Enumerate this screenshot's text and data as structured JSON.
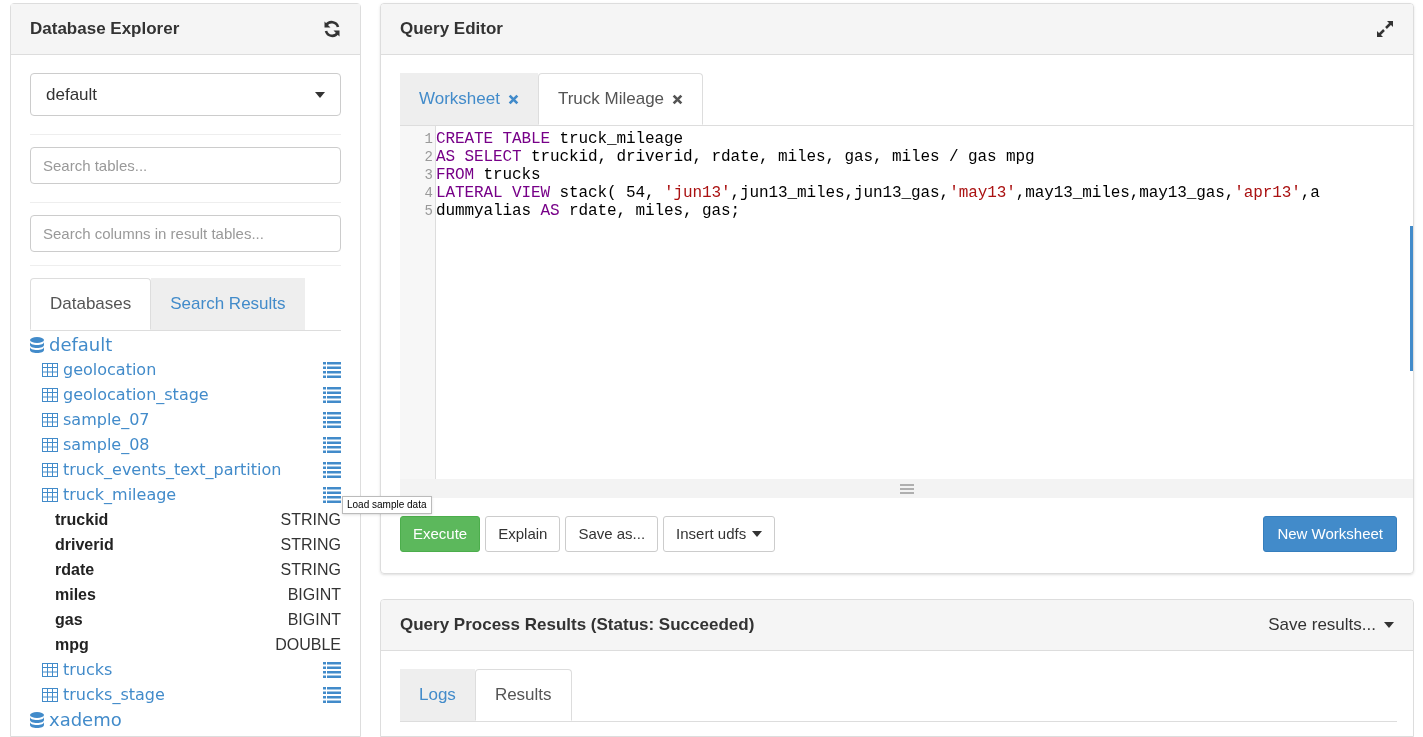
{
  "explorer": {
    "title": "Database Explorer",
    "database_select": {
      "value": "default"
    },
    "table_search": {
      "placeholder": "Search tables..."
    },
    "column_search": {
      "placeholder": "Search columns in result tables..."
    },
    "tabs": [
      {
        "label": "Databases",
        "selected": true
      },
      {
        "label": "Search Results",
        "selected": false
      }
    ],
    "tree": [
      {
        "kind": "database",
        "label": "default",
        "children": [
          {
            "kind": "table",
            "label": "geolocation"
          },
          {
            "kind": "table",
            "label": "geolocation_stage"
          },
          {
            "kind": "table",
            "label": "sample_07"
          },
          {
            "kind": "table",
            "label": "sample_08"
          },
          {
            "kind": "table",
            "label": "truck_events_text_partition"
          },
          {
            "kind": "table",
            "label": "truck_mileage",
            "tooltip": "Load sample data",
            "children": [
              {
                "kind": "column",
                "label": "truckid",
                "type": "STRING"
              },
              {
                "kind": "column",
                "label": "driverid",
                "type": "STRING"
              },
              {
                "kind": "column",
                "label": "rdate",
                "type": "STRING"
              },
              {
                "kind": "column",
                "label": "miles",
                "type": "BIGINT"
              },
              {
                "kind": "column",
                "label": "gas",
                "type": "BIGINT"
              },
              {
                "kind": "column",
                "label": "mpg",
                "type": "DOUBLE"
              }
            ]
          },
          {
            "kind": "table",
            "label": "trucks"
          },
          {
            "kind": "table",
            "label": "trucks_stage"
          }
        ]
      },
      {
        "kind": "database",
        "label": "xademo"
      }
    ]
  },
  "editor": {
    "title": "Query Editor",
    "tabs": [
      {
        "label": "Worksheet",
        "selected": false
      },
      {
        "label": "Truck Mileage",
        "selected": true
      }
    ],
    "lines": [
      {
        "number": "1",
        "tokens": [
          {
            "kind": "keyword",
            "text": "CREATE TABLE"
          },
          {
            "kind": "plain",
            "text": " truck_mileage"
          }
        ]
      },
      {
        "number": "2",
        "tokens": [
          {
            "kind": "keyword",
            "text": "AS SELECT"
          },
          {
            "kind": "plain",
            "text": " truckid, driverid, rdate, miles, gas, miles / gas mpg"
          }
        ]
      },
      {
        "number": "3",
        "tokens": [
          {
            "kind": "keyword",
            "text": "FROM"
          },
          {
            "kind": "plain",
            "text": " trucks"
          }
        ]
      },
      {
        "number": "4",
        "tokens": [
          {
            "kind": "keyword",
            "text": "LATERAL VIEW"
          },
          {
            "kind": "plain",
            "text": " stack( 54, "
          },
          {
            "kind": "string",
            "text": "'jun13'"
          },
          {
            "kind": "plain",
            "text": ",jun13_miles,jun13_gas,"
          },
          {
            "kind": "string",
            "text": "'may13'"
          },
          {
            "kind": "plain",
            "text": ",may13_miles,may13_gas,"
          },
          {
            "kind": "string",
            "text": "'apr13'"
          },
          {
            "kind": "plain",
            "text": ",a"
          }
        ]
      },
      {
        "number": "5",
        "tokens": [
          {
            "kind": "plain",
            "text": "dummyalias "
          },
          {
            "kind": "keyword",
            "text": "AS"
          },
          {
            "kind": "plain",
            "text": " rdate, miles, gas;"
          }
        ]
      }
    ],
    "buttons": [
      {
        "label": "Execute",
        "kind": "success"
      },
      {
        "label": "Explain",
        "kind": "default"
      },
      {
        "label": "Save as...",
        "kind": "default"
      },
      {
        "label": "Insert udfs",
        "kind": "dropdown"
      }
    ],
    "new_button": "New Worksheet"
  },
  "results": {
    "title": "Query Process Results (Status: Succeeded)",
    "save_menu": "Save results...",
    "tabs": [
      {
        "label": "Logs",
        "selected": false
      },
      {
        "label": "Results",
        "selected": true
      }
    ]
  }
}
